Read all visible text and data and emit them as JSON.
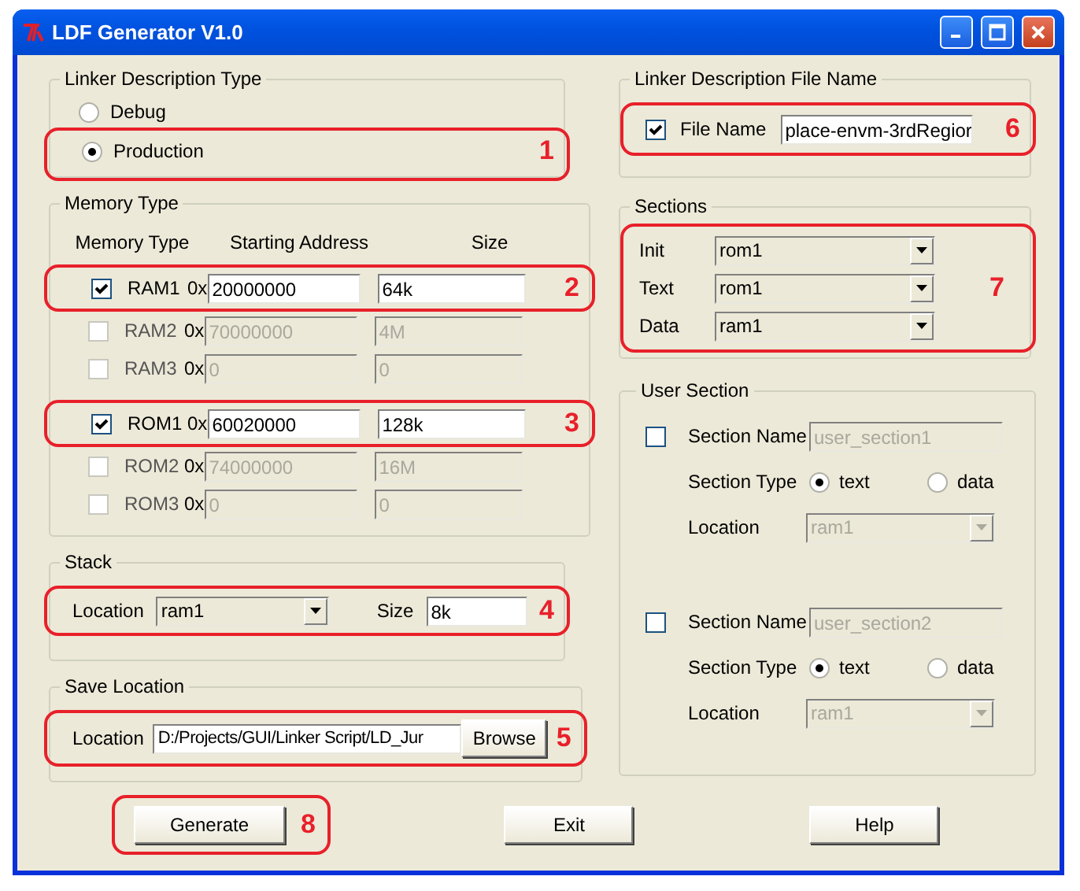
{
  "window": {
    "title": "LDF Generator V1.0"
  },
  "linker_description_type": {
    "title": "Linker Description Type",
    "callout": "1",
    "options": [
      {
        "label": "Debug",
        "selected": false
      },
      {
        "label": "Production",
        "selected": true
      }
    ]
  },
  "memory_type": {
    "title": "Memory Type",
    "headers": [
      "Memory Type",
      "Starting Address",
      "Size"
    ],
    "rows": [
      {
        "name": "RAM1",
        "checked": true,
        "prefix": "0x",
        "address": "20000000",
        "size": "64k",
        "callout": "2"
      },
      {
        "name": "RAM2",
        "checked": false,
        "prefix": "0x",
        "address": "70000000",
        "size": "4M"
      },
      {
        "name": "RAM3",
        "checked": false,
        "prefix": "0x",
        "address": "0",
        "size": "0"
      },
      {
        "name": "ROM1",
        "checked": true,
        "prefix": "0x",
        "address": "60020000",
        "size": "128k",
        "callout": "3"
      },
      {
        "name": "ROM2",
        "checked": false,
        "prefix": "0x",
        "address": "74000000",
        "size": "16M"
      },
      {
        "name": "ROM3",
        "checked": false,
        "prefix": "0x",
        "address": "0",
        "size": "0"
      }
    ]
  },
  "stack": {
    "title": "Stack",
    "location_label": "Location",
    "location": "ram1",
    "size_label": "Size",
    "size": "8k",
    "callout": "4"
  },
  "save_location": {
    "title": "Save Location",
    "label": "Location",
    "path": "D:/Projects/GUI/Linker Script/LD_Jur",
    "browse": "Browse",
    "callout": "5"
  },
  "file_name": {
    "title": "Linker Description File Name",
    "checked": true,
    "label": "File Name",
    "value": "place-envm-3rdRegior",
    "callout": "6"
  },
  "sections": {
    "title": "Sections",
    "callout": "7",
    "rows": [
      {
        "label": "Init",
        "value": "rom1"
      },
      {
        "label": "Text",
        "value": "rom1"
      },
      {
        "label": "Data",
        "value": "ram1"
      }
    ]
  },
  "user_section": {
    "title": "User Section",
    "entries": [
      {
        "checked": false,
        "name_label": "Section Name",
        "name": "user_section1",
        "type_label": "Section Type",
        "types": [
          {
            "label": "text",
            "selected": true
          },
          {
            "label": "data",
            "selected": false
          }
        ],
        "location_label": "Location",
        "location": "ram1"
      },
      {
        "checked": false,
        "name_label": "Section Name",
        "name": "user_section2",
        "type_label": "Section Type",
        "types": [
          {
            "label": "text",
            "selected": true
          },
          {
            "label": "data",
            "selected": false
          }
        ],
        "location_label": "Location",
        "location": "ram1"
      }
    ]
  },
  "buttons": [
    {
      "label": "Generate",
      "callout": "8"
    },
    {
      "label": "Exit"
    },
    {
      "label": "Help"
    }
  ]
}
